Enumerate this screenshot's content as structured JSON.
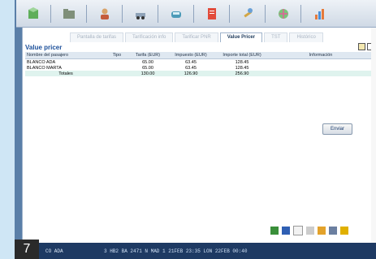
{
  "toolbar": {
    "icons": [
      "cube-icon",
      "folder-icon",
      "person-icon",
      "car-icon",
      "car-front-icon",
      "document-icon",
      "tools-icon",
      "globe-icon",
      "chart-icon"
    ]
  },
  "tabs": [
    {
      "label": "Pantalla de tarifas",
      "active": false
    },
    {
      "label": "Tarificación info",
      "active": false
    },
    {
      "label": "Tarificar PNR",
      "active": false
    },
    {
      "label": "Value Pricer",
      "active": true
    },
    {
      "label": "TST",
      "active": false
    },
    {
      "label": "Histórico",
      "active": false
    }
  ],
  "section": {
    "title": "Value pricer"
  },
  "table": {
    "headers": [
      "Nombre del pasajero",
      "Tipo",
      "Tarifa (EUR)",
      "Impuesto (EUR)",
      "Importe total (EUR)",
      "Información"
    ],
    "rows": [
      {
        "name": "BLANCO ADA",
        "tipo": "",
        "tarifa": "65.00",
        "impuesto": "63.45",
        "total": "128.45",
        "info": ""
      },
      {
        "name": "BLANCO MARTA",
        "tipo": "",
        "tarifa": "65.00",
        "impuesto": "63.45",
        "total": "128.45",
        "info": ""
      }
    ],
    "totals": {
      "label": "Totales",
      "tarifa": "130.00",
      "impuesto": "126.90",
      "total": "256.90"
    }
  },
  "buttons": {
    "enviar": "Enviar"
  },
  "status": {
    "badge": "7",
    "left": "CO ADA",
    "line": "3 HB2 BA  2471  N    MAD  1 21FEB  23:35   LON 22FEB  00:40"
  },
  "colors": {
    "accent": "#1b4f9a",
    "status_bg": "#1e3a63",
    "total_row": "#dff3ee"
  }
}
